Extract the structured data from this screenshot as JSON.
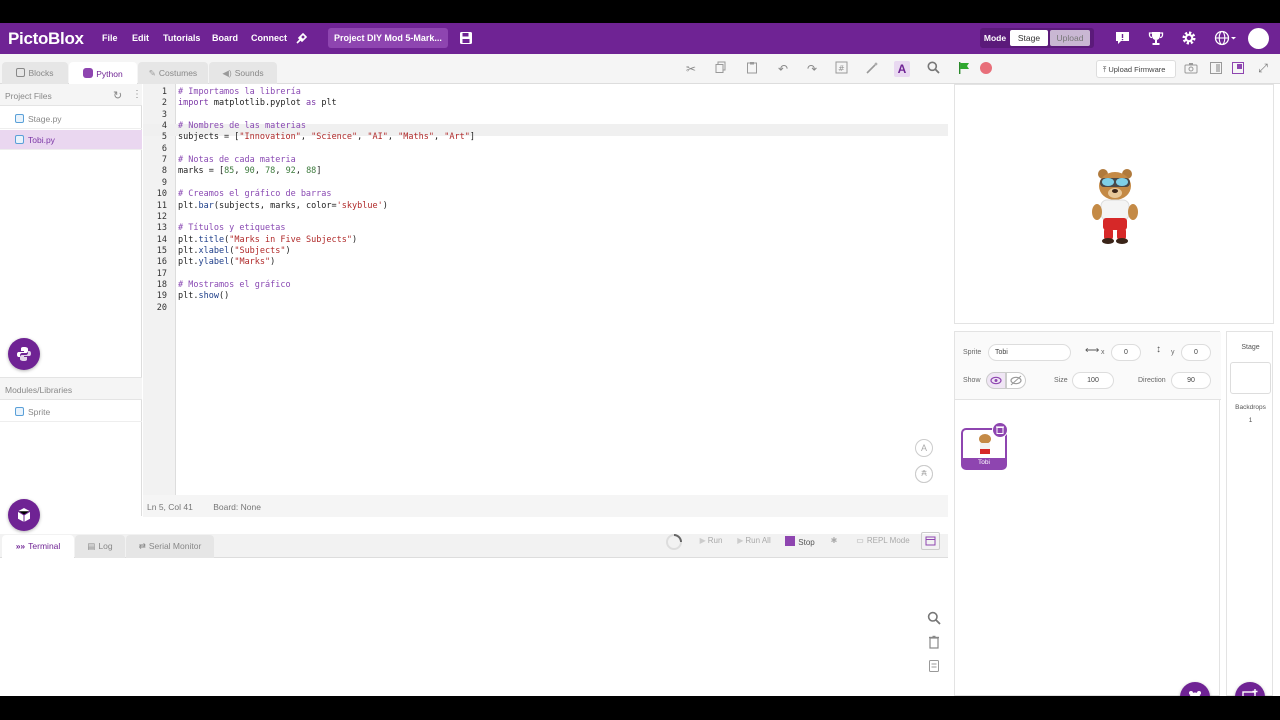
{
  "app": {
    "logo": "PictoBlox",
    "project_name": "Project DIY  Mod 5-Mark...",
    "upload_firmware": "Upload Firmware"
  },
  "menu": [
    "File",
    "Edit",
    "Tutorials",
    "Board",
    "Connect"
  ],
  "mode": {
    "label": "Mode",
    "stage": "Stage",
    "upload": "Upload"
  },
  "tabs": {
    "blocks": "Blocks",
    "python": "Python",
    "costumes": "Costumes",
    "sounds": "Sounds"
  },
  "left": {
    "project_files": "Project Files",
    "files": [
      "Stage.py",
      "Tobi.py"
    ],
    "modules": "Modules/Libraries",
    "modules_items": [
      "Sprite"
    ]
  },
  "code": [
    "# Importamos la librería",
    "import matplotlib.pyplot as plt",
    "",
    "# Nombres de las materias",
    "subjects = [\"Innovation\", \"Science\", \"AI\", \"Maths\", \"Art\"]",
    "",
    "# Notas de cada materia",
    "marks = [85, 90, 78, 92, 88]",
    "",
    "# Creamos el gráfico de barras",
    "plt.bar(subjects, marks, color='skyblue')",
    "",
    "# Títulos y etiquetas",
    "plt.title(\"Marks in Five Subjects\")",
    "plt.xlabel(\"Subjects\")",
    "plt.ylabel(\"Marks\")",
    "",
    "# Mostramos el gráfico",
    "plt.show()",
    ""
  ],
  "status": {
    "cursor": "Ln 5, Col 41",
    "board": "Board: None"
  },
  "terminal": {
    "tabs": [
      "Terminal",
      "Log",
      "Serial Monitor"
    ],
    "run": "Run",
    "run_all": "Run All",
    "stop": "Stop",
    "repl": "REPL Mode"
  },
  "sprite": {
    "label": "Sprite",
    "name": "Tobi",
    "x_label": "x",
    "x": "0",
    "y_label": "y",
    "y": "0",
    "show_label": "Show",
    "size_label": "Size",
    "size": "100",
    "direction_label": "Direction",
    "direction": "90",
    "thumb_name": "Tobi"
  },
  "stage_panel": {
    "title": "Stage",
    "backdrops_label": "Backdrops",
    "backdrops_count": "1"
  },
  "colors": {
    "brand": "#6f2394",
    "accent_light": "#e9d9f1"
  }
}
